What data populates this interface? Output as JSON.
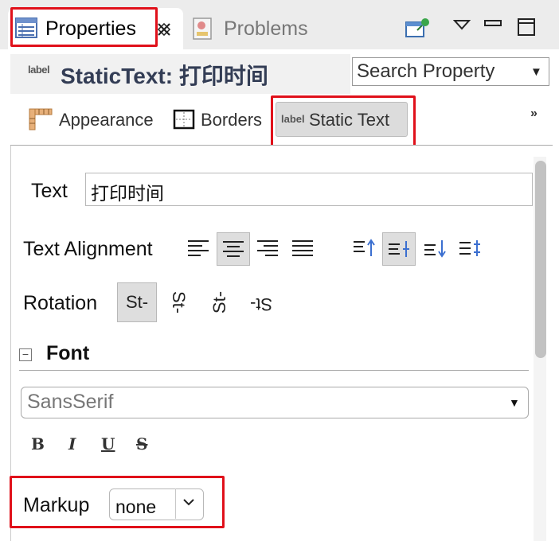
{
  "tabs": {
    "properties_label": "Properties",
    "problems_label": "Problems"
  },
  "header": {
    "title": "StaticText: 打印时间",
    "label_badge": "label",
    "search_value": "Search Property"
  },
  "sections": {
    "appearance": "Appearance",
    "borders": "Borders",
    "static_text": "Static Text",
    "static_badge": "label",
    "more": "»"
  },
  "fields": {
    "text_label": "Text",
    "text_value": "打印时间",
    "alignment_label": "Text Alignment",
    "rotation_label": "Rotation",
    "rotation_options": [
      "St-",
      "St-",
      "St-",
      "St-"
    ],
    "font_section": "Font",
    "collapse_glyph": "−",
    "font_value": "SansSerif",
    "style_bold": "B",
    "style_italic": "I",
    "style_underline": "U",
    "style_strike": "S",
    "markup_label": "Markup",
    "markup_value": "none"
  },
  "colors": {
    "highlight_border": "#e0101a",
    "title": "#333d55"
  }
}
